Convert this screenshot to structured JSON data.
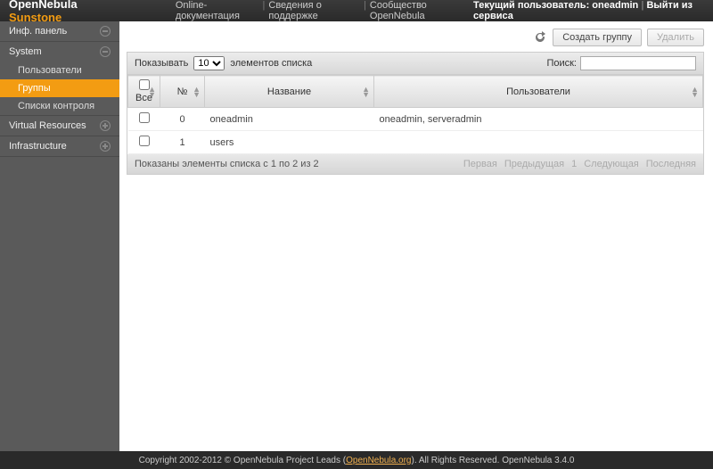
{
  "header": {
    "logo1": "OpenNebula",
    "logo2": "Sunstone",
    "links": [
      "Online-документация",
      "Сведения о поддержке",
      "Сообщество OpenNebula"
    ],
    "current_user_label": "Текущий пользователь:",
    "current_user": "oneadmin",
    "signout": "Выйти из сервиса"
  },
  "sidebar": {
    "items": [
      {
        "label": "Инф. панель",
        "icon": "minus",
        "subs": []
      },
      {
        "label": "System",
        "icon": "minus",
        "subs": [
          {
            "label": "Пользователи",
            "active": false
          },
          {
            "label": "Группы",
            "active": true
          },
          {
            "label": "Списки контроля",
            "active": false
          }
        ]
      },
      {
        "label": "Virtual Resources",
        "icon": "plus",
        "subs": []
      },
      {
        "label": "Infrastructure",
        "icon": "plus",
        "subs": []
      }
    ]
  },
  "toolbar": {
    "create": "Создать группу",
    "delete": "Удалить"
  },
  "controls": {
    "show_label": "Показывать",
    "page_size": "10",
    "entries_label": "элементов списка",
    "search_label": "Поиск:"
  },
  "table": {
    "headers": {
      "all": "Все",
      "id": "№",
      "name": "Название",
      "users": "Пользователи"
    },
    "rows": [
      {
        "id": "0",
        "name": "oneadmin",
        "users": "oneadmin, serveradmin"
      },
      {
        "id": "1",
        "name": "users",
        "users": ""
      }
    ],
    "summary": "Показаны элементы списка с 1 по 2 из 2",
    "pager": {
      "first": "Первая",
      "prev": "Предыдущая",
      "page": "1",
      "next": "Следующая",
      "last": "Последняя"
    }
  },
  "footer": {
    "text1": "Copyright 2002-2012 © OpenNebula Project Leads (",
    "link": "OpenNebula.org",
    "text2": "). All Rights Reserved. OpenNebula 3.4.0"
  }
}
